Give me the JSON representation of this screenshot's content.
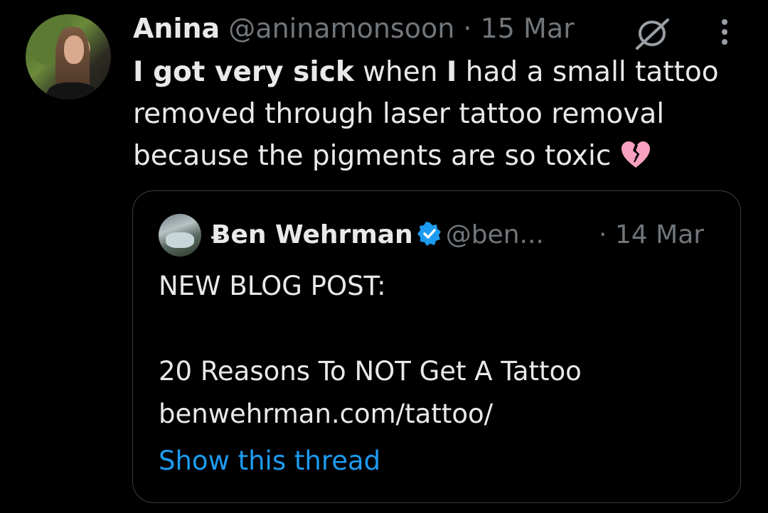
{
  "tweet": {
    "author_name": "Anina",
    "handle": "@aninamonsoon",
    "separator": "·",
    "date": "15 Mar",
    "text_bold_1": "I got very sick",
    "text_1": " when ",
    "text_bold_2": "I",
    "text_2": " had a small tattoo removed through laser tattoo removal because the pigments are so toxic ",
    "emoji_icon": "broken-heart-icon"
  },
  "quote": {
    "author_name": "Ƀen Wehrman",
    "verified": true,
    "handle": "@ben...",
    "date": "· 14 Mar",
    "text": "NEW BLOG POST:\n\n20 Reasons To NOT Get A Tattoo\nbenwehrman.com/tattoo/",
    "show_thread_label": "Show this thread"
  },
  "colors": {
    "background": "#000000",
    "text": "#e7e9ea",
    "muted": "#71767b",
    "link": "#1d9bf0",
    "border": "#3a3e42",
    "verified": "#1d9bf0",
    "heart": "#f7a0c0"
  }
}
